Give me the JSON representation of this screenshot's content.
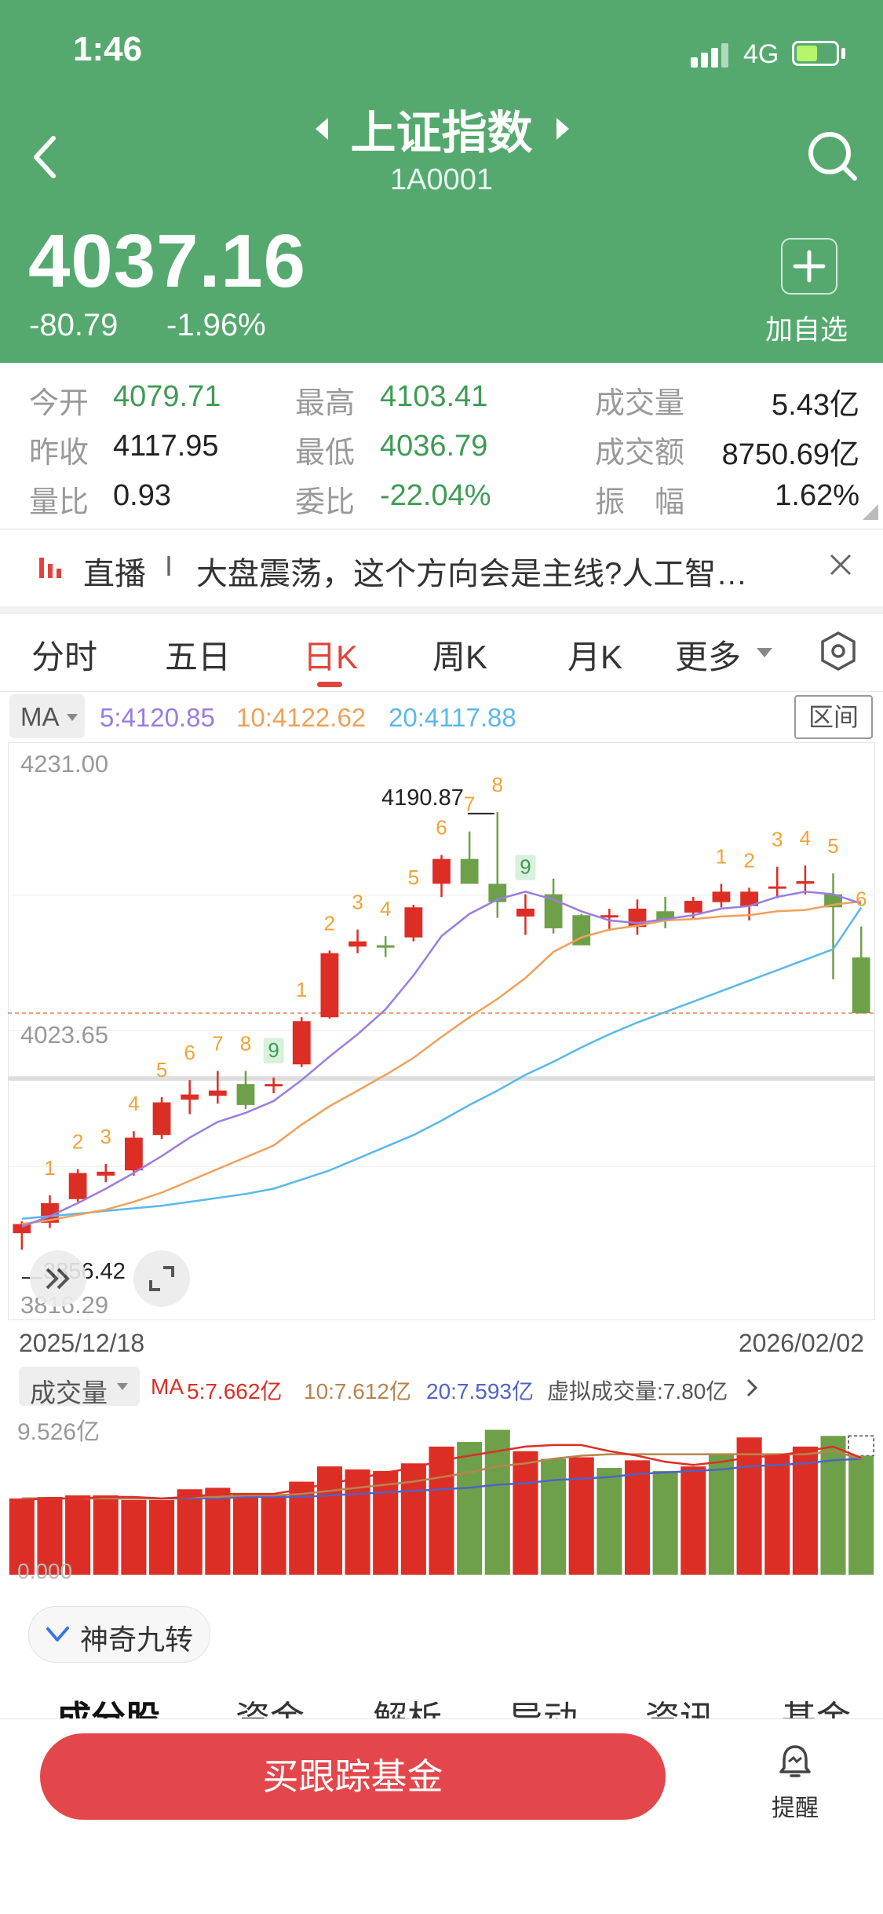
{
  "status_bar": {
    "time": "1:46",
    "network": "4G"
  },
  "header": {
    "title": "上证指数",
    "code": "1A0001",
    "price": "4037.16",
    "change": "-80.79",
    "change_pct": "-1.96%",
    "add_label": "加自选",
    "bg_color": "#55a96f"
  },
  "stats": {
    "open_label": "今开",
    "open": "4079.71",
    "prev_close_label": "昨收",
    "prev_close": "4117.95",
    "vol_ratio_label": "量比",
    "vol_ratio": "0.93",
    "high_label": "最高",
    "high": "4103.41",
    "low_label": "最低",
    "low": "4036.79",
    "commit_ratio_label": "委比",
    "commit_ratio": "-22.04%",
    "volume_label": "成交量",
    "volume": "5.43亿",
    "amount_label": "成交额",
    "amount": "8750.69亿",
    "amplitude_label": "振　幅",
    "amplitude": "1.62%"
  },
  "live": {
    "tag": "直播",
    "sep": "I",
    "text": "大盘震荡，这个方向会是主线?人工智…"
  },
  "tabs": [
    {
      "label": "分时"
    },
    {
      "label": "五日"
    },
    {
      "label": "日K"
    },
    {
      "label": "周K"
    },
    {
      "label": "月K"
    },
    {
      "label": "更多"
    }
  ],
  "active_tab": "日K",
  "ma_bar": {
    "selector": "MA",
    "ma5": "5:4120.85",
    "ma10": "10:4122.62",
    "ma20": "20:4117.88",
    "range_button": "区间"
  },
  "colors": {
    "up": "#dd2e26",
    "down": "#6ea04a",
    "ma5": "#9a7de0",
    "ma10": "#f0a05a",
    "ma20": "#5ab8ea",
    "active": "#e0443a"
  },
  "chart_data": [
    {
      "type": "candlestick",
      "y_axis_labels": [
        "4231.00",
        "4023.65",
        "3816.29"
      ],
      "ylim": [
        3816.29,
        4231.0
      ],
      "x_labels": [
        "2025/12/18",
        "2026/02/02"
      ],
      "max_label": "4190.87",
      "min_label": "3856.42",
      "nine_turn_marks": [
        "1",
        "2",
        "3",
        "4",
        "5",
        "6",
        "7",
        "8",
        "9",
        "1",
        "2",
        "3",
        "4",
        "5",
        "6",
        "7",
        "8",
        "9",
        "1",
        "2",
        "3",
        "4",
        "5",
        "6"
      ],
      "candles": [
        {
          "o": 3869,
          "h": 3878,
          "l": 3856.42,
          "c": 3876
        },
        {
          "o": 3877,
          "h": 3898,
          "l": 3873,
          "c": 3892
        },
        {
          "o": 3895,
          "h": 3918,
          "l": 3893,
          "c": 3915
        },
        {
          "o": 3913,
          "h": 3922,
          "l": 3908,
          "c": 3916
        },
        {
          "o": 3917,
          "h": 3947,
          "l": 3913,
          "c": 3942
        },
        {
          "o": 3944,
          "h": 3973,
          "l": 3941,
          "c": 3969
        },
        {
          "o": 3971,
          "h": 3986,
          "l": 3960,
          "c": 3975
        },
        {
          "o": 3974,
          "h": 3993,
          "l": 3968,
          "c": 3978
        },
        {
          "o": 3983,
          "h": 3993,
          "l": 3964,
          "c": 3967
        },
        {
          "o": 3982,
          "h": 3988,
          "l": 3976,
          "c": 3983
        },
        {
          "o": 3998,
          "h": 4034,
          "l": 3996,
          "c": 4031
        },
        {
          "o": 4034,
          "h": 4085,
          "l": 4033,
          "c": 4083
        },
        {
          "o": 4088,
          "h": 4101,
          "l": 4083,
          "c": 4092
        },
        {
          "o": 4089,
          "h": 4096,
          "l": 4080,
          "c": 4088
        },
        {
          "o": 4095,
          "h": 4120,
          "l": 4092,
          "c": 4118
        },
        {
          "o": 4136,
          "h": 4158,
          "l": 4126,
          "c": 4155
        },
        {
          "o": 4155,
          "h": 4176,
          "l": 4138,
          "c": 4136
        },
        {
          "o": 4136,
          "h": 4190.87,
          "l": 4110,
          "c": 4122
        },
        {
          "o": 4111,
          "h": 4128,
          "l": 4097,
          "c": 4117
        },
        {
          "o": 4128,
          "h": 4140,
          "l": 4098,
          "c": 4102
        },
        {
          "o": 4112,
          "h": 4113,
          "l": 4090,
          "c": 4089
        },
        {
          "o": 4111,
          "h": 4117,
          "l": 4100,
          "c": 4112
        },
        {
          "o": 4103,
          "h": 4124,
          "l": 4097,
          "c": 4117
        },
        {
          "o": 4115,
          "h": 4126,
          "l": 4102,
          "c": 4108
        },
        {
          "o": 4114,
          "h": 4126,
          "l": 4109,
          "c": 4123
        },
        {
          "o": 4122,
          "h": 4136,
          "l": 4118,
          "c": 4130
        },
        {
          "o": 4119,
          "h": 4133,
          "l": 4108,
          "c": 4130
        },
        {
          "o": 4133,
          "h": 4149,
          "l": 4125,
          "c": 4134
        },
        {
          "o": 4136,
          "h": 4150,
          "l": 4128,
          "c": 4138
        },
        {
          "o": 4128,
          "h": 4144,
          "l": 4063,
          "c": 4118
        },
        {
          "o": 4079.71,
          "h": 4103.41,
          "l": 4036.79,
          "c": 4037.16
        }
      ],
      "ma5": [
        3874,
        3882,
        3892,
        3903,
        3915,
        3928,
        3942,
        3954,
        3961,
        3970,
        3986,
        4004,
        4021,
        4040,
        4066,
        4096,
        4113,
        4124,
        4130,
        4124,
        4115,
        4108,
        4106,
        4109,
        4112,
        4117,
        4119,
        4126,
        4130,
        4128,
        4120.85
      ],
      "ma10": [
        3876,
        3879,
        3883,
        3887,
        3893,
        3900,
        3909,
        3918,
        3927,
        3936,
        3952,
        3966,
        3978,
        3990,
        4003,
        4019,
        4034,
        4048,
        4064,
        4084,
        4095,
        4101,
        4104,
        4108,
        4109,
        4111,
        4112,
        4115,
        4116,
        4120,
        4122.62
      ],
      "ma20": [
        3880,
        3882,
        3884,
        3886,
        3888,
        3890,
        3893,
        3896,
        3899,
        3903,
        3910,
        3917,
        3926,
        3935,
        3944,
        3955,
        3967,
        3978,
        3990,
        4000,
        4011,
        4021,
        4030,
        4038,
        4046,
        4054,
        4062,
        4070,
        4078,
        4086,
        4117.88
      ]
    },
    {
      "type": "bar",
      "title": "成交量",
      "ylim": [
        0,
        9.526
      ],
      "y_axis_labels": [
        "9.526亿",
        "0.000"
      ],
      "ma_labels": {
        "ma": "MA",
        "ma5": "5:7.662亿",
        "ma10": "10:7.612亿",
        "ma20": "20:7.593亿",
        "virtual": "虚拟成交量:7.80亿"
      },
      "values": [
        5.0,
        5.1,
        5.2,
        5.2,
        4.9,
        4.9,
        5.6,
        5.7,
        5.3,
        5.2,
        6.1,
        7.1,
        6.9,
        6.8,
        7.3,
        8.4,
        8.7,
        9.5,
        8.1,
        7.6,
        7.7,
        7.0,
        7.5,
        6.8,
        7.1,
        7.9,
        9.0,
        7.9,
        8.4,
        9.1,
        7.8
      ],
      "directions": [
        "up",
        "up",
        "up",
        "up",
        "up",
        "up",
        "up",
        "up",
        "up",
        "up",
        "up",
        "up",
        "up",
        "up",
        "up",
        "up",
        "down",
        "down",
        "up",
        "down",
        "up",
        "down",
        "up",
        "down",
        "up",
        "down",
        "up",
        "up",
        "up",
        "down",
        "down"
      ],
      "ma5_line": [
        4.9,
        5.0,
        5.0,
        5.1,
        5.1,
        5.0,
        5.1,
        5.3,
        5.3,
        5.3,
        5.6,
        6.0,
        6.3,
        6.7,
        7.0,
        7.5,
        7.8,
        8.1,
        8.4,
        8.5,
        8.5,
        8.1,
        7.8,
        7.4,
        7.2,
        7.4,
        7.7,
        7.8,
        8.1,
        8.4,
        7.662
      ],
      "ma10_line": [
        5.0,
        5.0,
        5.0,
        5.0,
        5.0,
        5.0,
        5.1,
        5.1,
        5.2,
        5.2,
        5.3,
        5.5,
        5.7,
        5.9,
        6.1,
        6.4,
        6.7,
        7.1,
        7.3,
        7.6,
        7.8,
        7.9,
        7.9,
        7.9,
        7.9,
        7.9,
        7.9,
        7.9,
        7.9,
        8.1,
        7.612
      ],
      "ma20_line": [
        5.0,
        5.0,
        5.0,
        5.0,
        5.0,
        5.0,
        5.0,
        5.0,
        5.1,
        5.1,
        5.1,
        5.2,
        5.3,
        5.4,
        5.5,
        5.6,
        5.7,
        5.9,
        6.0,
        6.2,
        6.3,
        6.4,
        6.6,
        6.7,
        6.8,
        6.9,
        7.1,
        7.2,
        7.3,
        7.5,
        7.593
      ]
    }
  ],
  "magic_nine": "神奇九转",
  "sub_tabs": [
    "成分股",
    "资金",
    "解析",
    "异动",
    "资讯",
    "基金"
  ],
  "bottom": {
    "buy_button": "买跟踪基金",
    "remind_label": "提醒"
  }
}
